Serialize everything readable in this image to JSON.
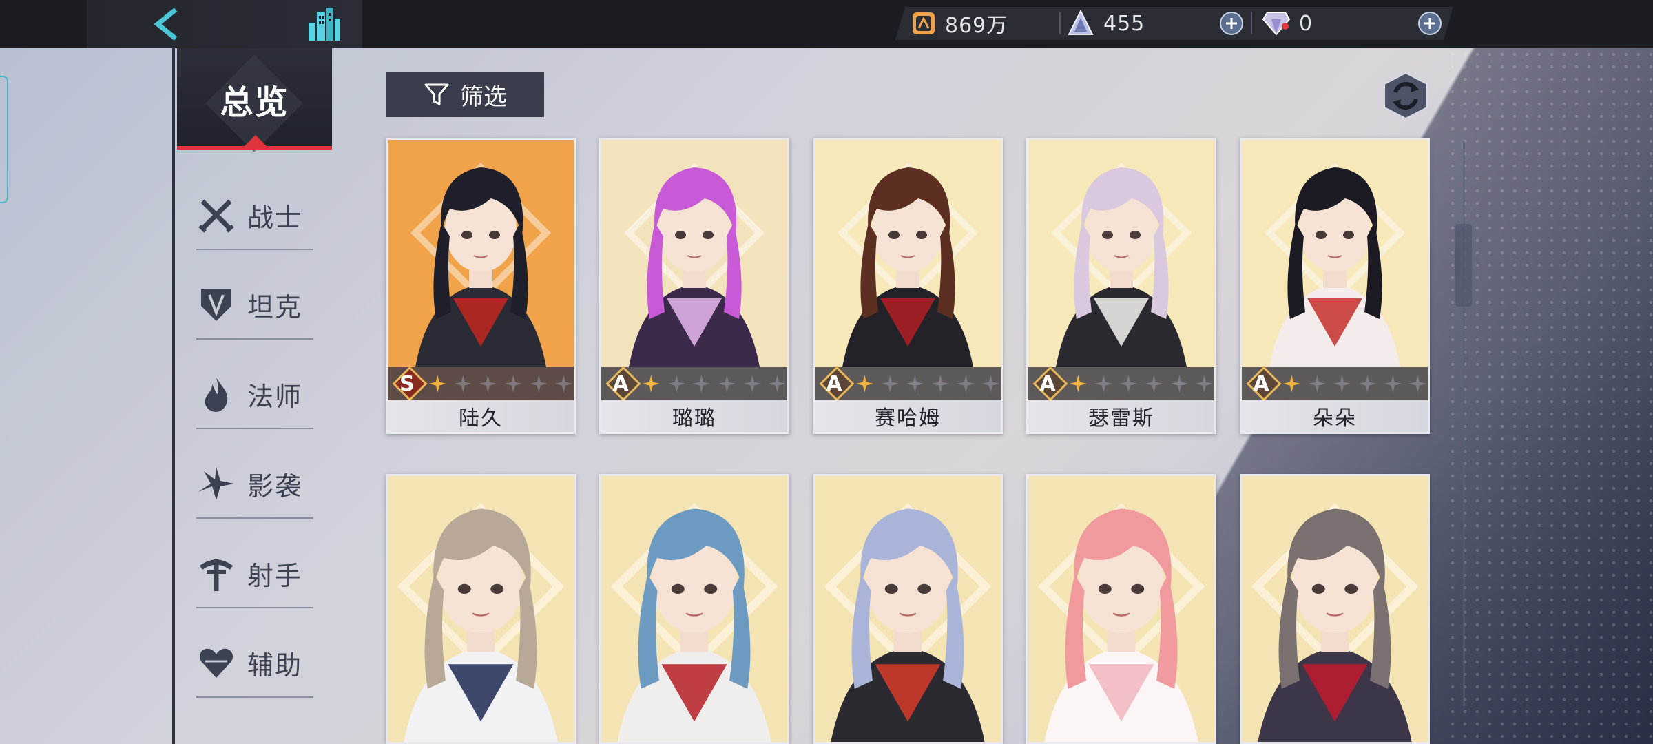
{
  "resources": {
    "gold": "869万",
    "stamina": "455",
    "diamonds": "0"
  },
  "sidebar": {
    "overview": "总览",
    "classes": [
      {
        "label": "战士",
        "icon": "swords-icon"
      },
      {
        "label": "坦克",
        "icon": "shield-icon"
      },
      {
        "label": "法师",
        "icon": "flame-icon"
      },
      {
        "label": "影袭",
        "icon": "shuriken-icon"
      },
      {
        "label": "射手",
        "icon": "crossbow-icon"
      },
      {
        "label": "辅助",
        "icon": "heart-icon"
      }
    ]
  },
  "filter": {
    "label": "筛选"
  },
  "characters": [
    {
      "name": "陆久",
      "grade": "S",
      "stars": 1,
      "bg": "#f1a34a",
      "hair": "#1e1f2a",
      "outfit": "#2b2b35",
      "accent": "#c2271f"
    },
    {
      "name": "璐璐",
      "grade": "A",
      "stars": 1,
      "bg": "#f2e3bd",
      "hair": "#c85ad8",
      "outfit": "#3b2a4a",
      "accent": "#e6b7f0"
    },
    {
      "name": "赛哈姆",
      "grade": "A",
      "stars": 1,
      "bg": "#f6e8b8",
      "hair": "#5c2f22",
      "outfit": "#222228",
      "accent": "#b01e24"
    },
    {
      "name": "瑟雷斯",
      "grade": "A",
      "stars": 1,
      "bg": "#f6e8b8",
      "hair": "#d9c8de",
      "outfit": "#2a2a30",
      "accent": "#f4f1ec"
    },
    {
      "name": "朵朵",
      "grade": "A",
      "stars": 1,
      "bg": "#f6e8b8",
      "hair": "#1c1a22",
      "outfit": "#f4ecea",
      "accent": "#c4302e"
    },
    {
      "name": "",
      "grade": "",
      "stars": 0,
      "bg": "#f4e4b4",
      "hair": "#b8a898",
      "outfit": "#f2f2f4",
      "accent": "#1e2a52"
    },
    {
      "name": "",
      "grade": "",
      "stars": 0,
      "bg": "#f4e4b4",
      "hair": "#6d9ac0",
      "outfit": "#f0eeec",
      "accent": "#b51e26"
    },
    {
      "name": "",
      "grade": "",
      "stars": 0,
      "bg": "#f4e4b4",
      "hair": "#a9b4d8",
      "outfit": "#2a2a30",
      "accent": "#d83a2a"
    },
    {
      "name": "",
      "grade": "",
      "stars": 0,
      "bg": "#f4e4b4",
      "hair": "#f19a9e",
      "outfit": "#fbf5f5",
      "accent": "#f2b6c0"
    },
    {
      "name": "",
      "grade": "",
      "stars": 0,
      "bg": "#f4e4b4",
      "hair": "#7a7070",
      "outfit": "#3c3648",
      "accent": "#c21a30"
    }
  ],
  "colors": {
    "accent_red": "#e0343d",
    "teal": "#4bb6c7",
    "gold": "#e8b85a"
  }
}
